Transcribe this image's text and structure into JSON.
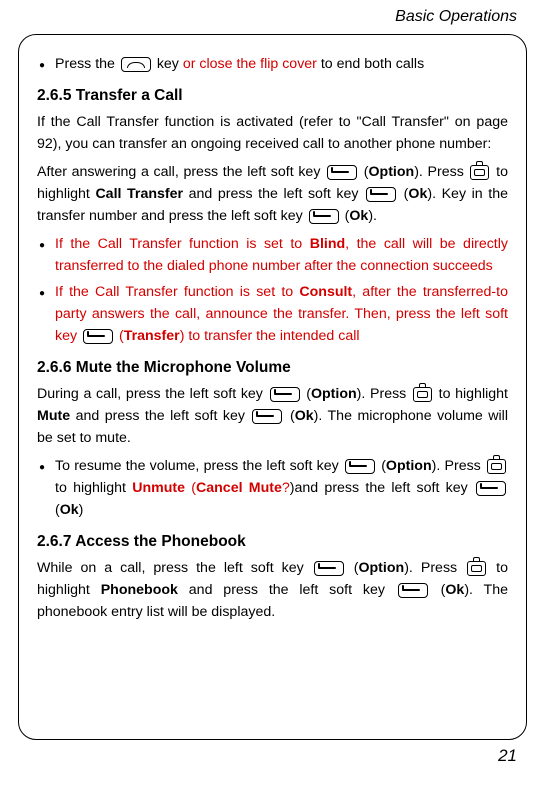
{
  "header": "Basic Operations",
  "pageNumber": "21",
  "bullet1": {
    "pre": "Press the ",
    "red": "or close the flip cover",
    "post": " to end both calls"
  },
  "s265": {
    "title": "2.6.5 Transfer a Call",
    "p1": "If the Call Transfer function is activated (refer to \"Call Transfer\" on page 92), you can transfer an ongoing received call to another phone number:",
    "p2a": "After answering a call, press the left soft key ",
    "p2b": " (",
    "p2c": "). Press ",
    "p2d": " to highlight ",
    "p2e": " and press the left soft key ",
    "p2f": " (",
    "p2g": "). Key in the transfer number and press the left soft key ",
    "p2h": " (",
    "p2i": ").",
    "option": "Option",
    "callTransfer": "Call Transfer",
    "ok": "Ok",
    "b1a": "If the Call Transfer function is set to ",
    "b1bold": "Blind",
    "b1b": ", the call will be directly transferred to the dialed phone number after the connection succeeds",
    "b2a": "If the Call Transfer function is set to ",
    "b2bold": "Consult",
    "b2b": ", after the transferred-to party answers the call, announce the transfer. Then, press the left soft key ",
    "b2c": " (",
    "b2transfer": "Transfer",
    "b2d": ") to transfer the intended call"
  },
  "s266": {
    "title": "2.6.6 Mute the Microphone Volume",
    "p1a": "During a call, press the left soft key ",
    "p1b": " (",
    "option": "Option",
    "p1c": "). Press ",
    "p1d": " to highlight ",
    "mute": "Mute",
    "p1e": " and press the left soft key ",
    "p1f": " (",
    "ok": "Ok",
    "p1g": "). The microphone volume will be set to mute.",
    "b1a": "To resume the volume, press the left soft key ",
    "b1b": " (",
    "b1c": "). Press ",
    "b1d": " to highlight ",
    "unmute": "Unmute",
    "b1e": " (",
    "cancelMute": "Cancel Mute",
    "b1q": "?",
    "b1f": ")and press the left soft key ",
    "b1g": " (",
    "b1h": ")"
  },
  "s267": {
    "title": "2.6.7 Access the Phonebook",
    "p1a": "While on a call, press the left soft key ",
    "p1b": " (",
    "option": "Option",
    "p1c": "). Press ",
    "p1d": " to highlight ",
    "phonebook": "Phonebook",
    "p1e": " and press the left soft key ",
    "p1f": " (",
    "ok": "Ok",
    "p1g": "). The phonebook entry list will be displayed."
  }
}
